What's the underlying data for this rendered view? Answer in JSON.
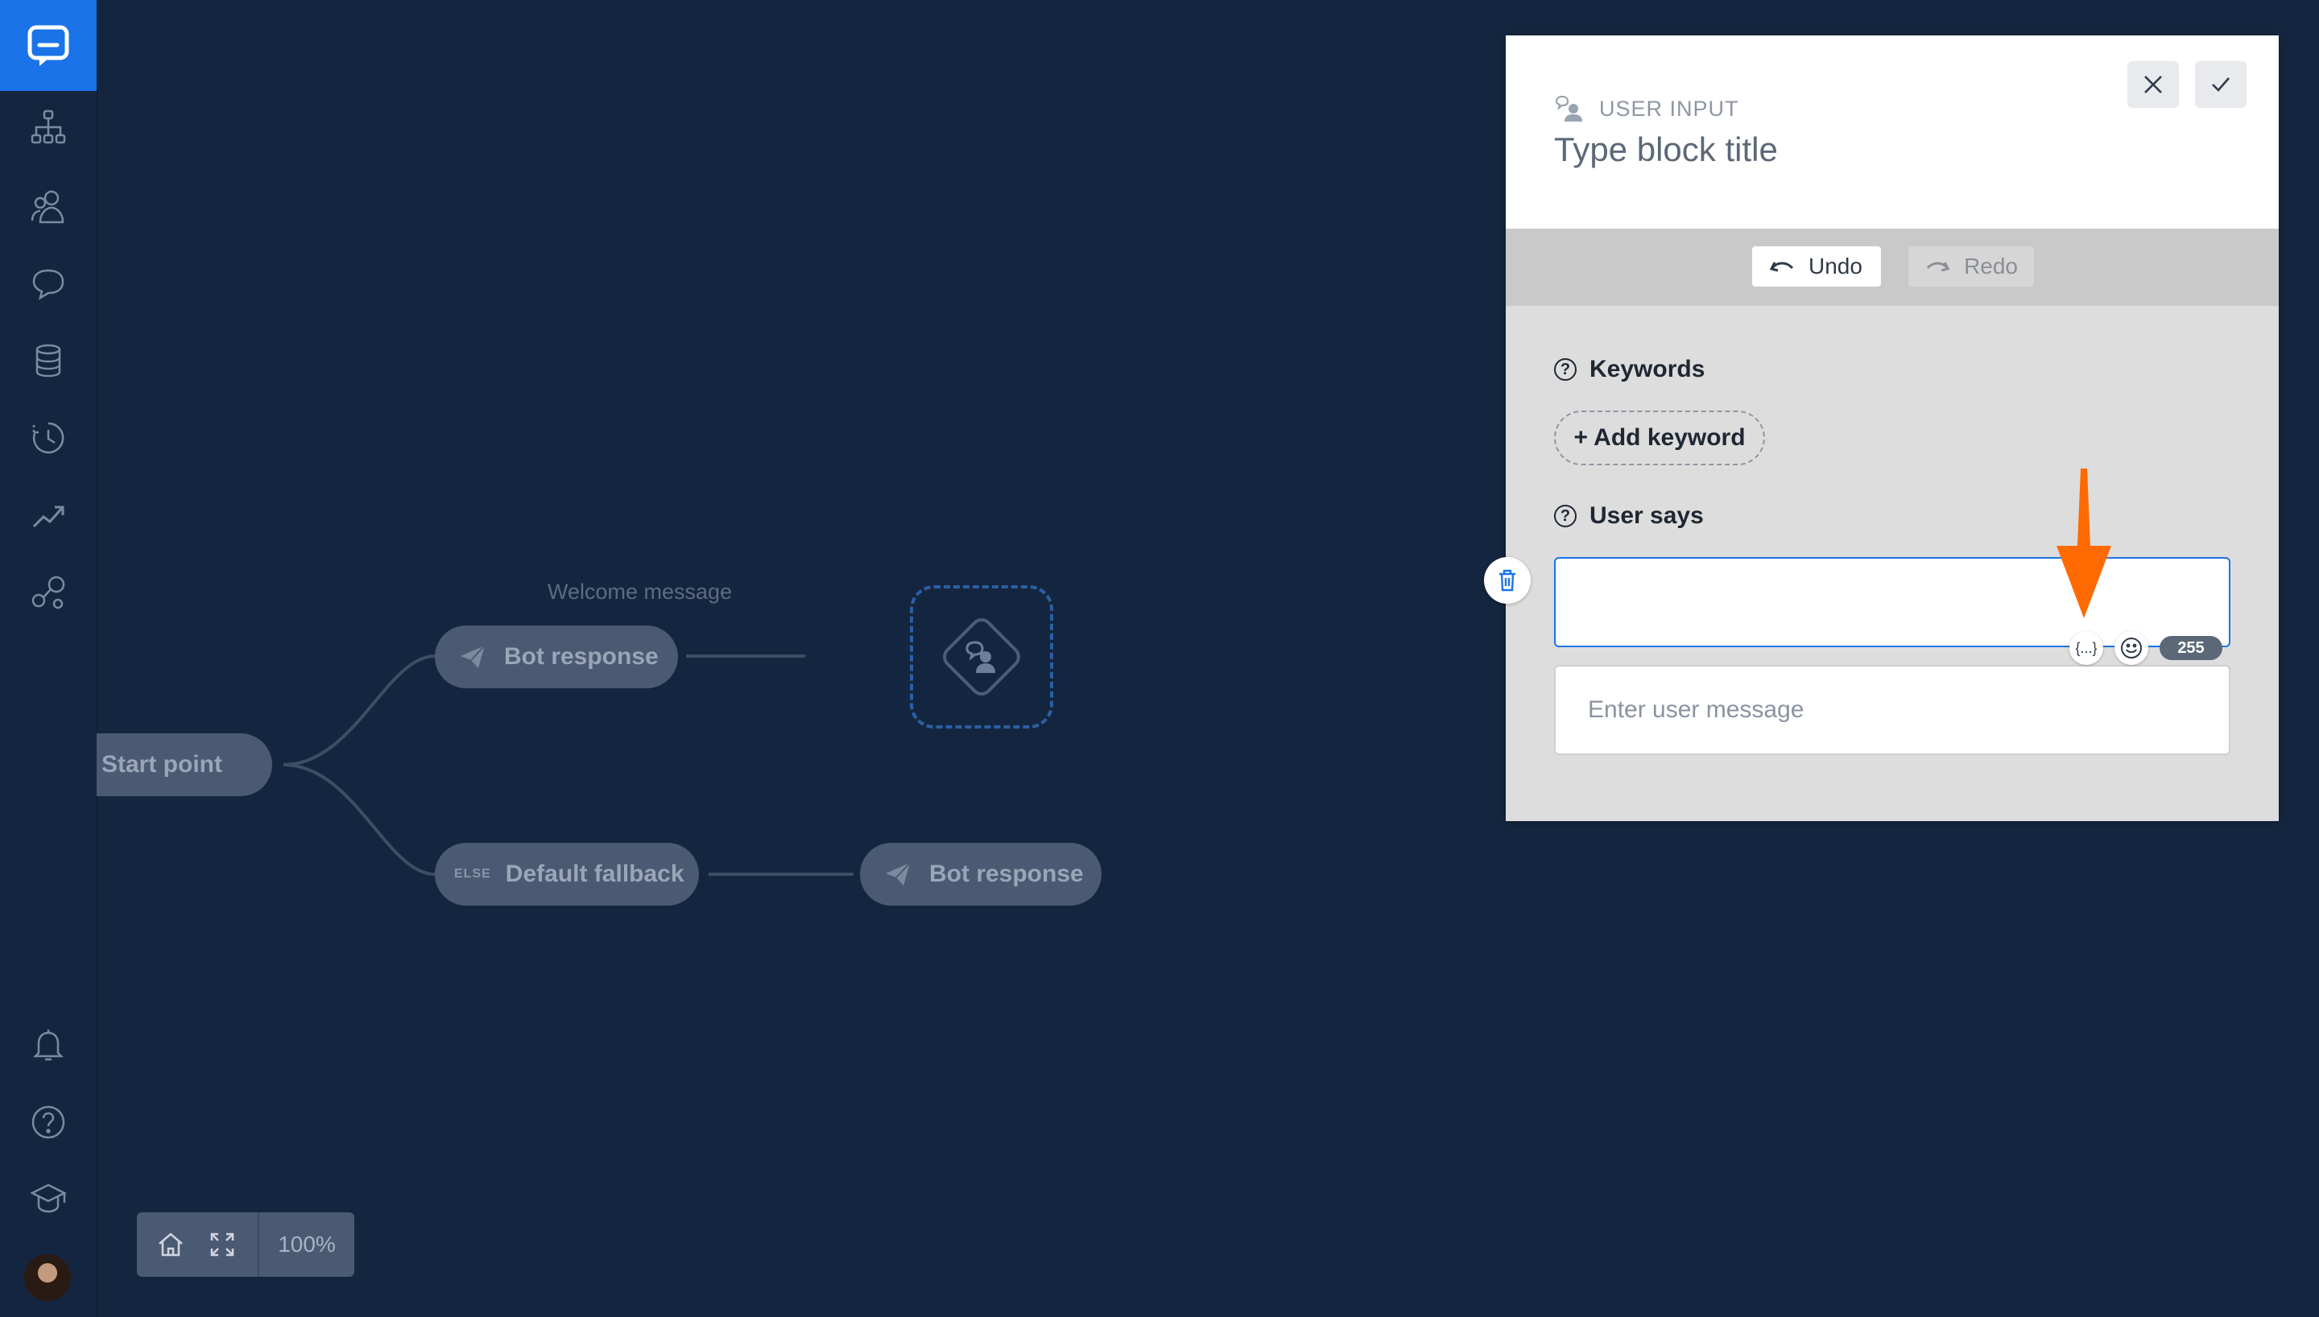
{
  "sidebar": {
    "items": [
      {
        "icon": "flow-diagram-icon"
      },
      {
        "icon": "users-icon"
      },
      {
        "icon": "chat-bubbles-icon"
      },
      {
        "icon": "database-icon"
      },
      {
        "icon": "history-icon"
      },
      {
        "icon": "analytics-icon"
      },
      {
        "icon": "integrations-icon"
      }
    ],
    "bottom": [
      {
        "icon": "bell-icon"
      },
      {
        "icon": "help-icon"
      },
      {
        "icon": "graduation-cap-icon"
      }
    ]
  },
  "canvas": {
    "start_node": "Start point",
    "welcome_label": "Welcome message",
    "bot_response_1": "Bot response",
    "fallback_tag": "ELSE",
    "fallback_node": "Default fallback",
    "bot_response_2": "Bot response",
    "zoom": "100%"
  },
  "panel": {
    "type_label": "USER INPUT",
    "title_placeholder": "Type block title",
    "undo_label": "Undo",
    "redo_label": "Redo",
    "keywords_label": "Keywords",
    "add_keyword_label": "+ Add keyword",
    "user_says_label": "User says",
    "active_message": "",
    "message_placeholder": "Enter user message",
    "variable_button": "{...}",
    "char_count": "255"
  },
  "colors": {
    "background": "#14263f",
    "accent": "#1a73e8",
    "annotation_arrow": "#ff6a00"
  }
}
